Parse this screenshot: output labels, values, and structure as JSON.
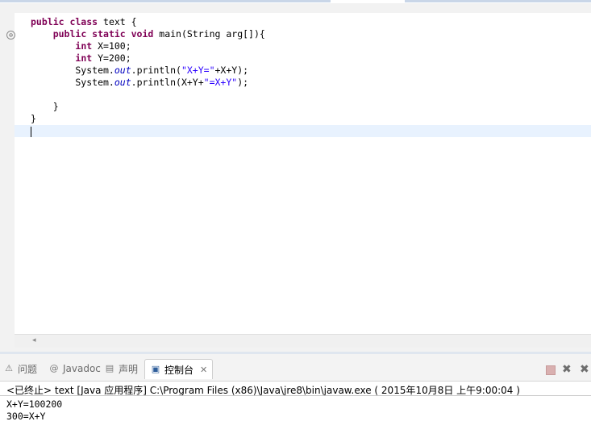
{
  "editor": {
    "code_lines": [
      [
        {
          "t": "public class ",
          "c": "kw"
        },
        {
          "t": "text {",
          "c": ""
        }
      ],
      [
        {
          "t": "    ",
          "c": ""
        },
        {
          "t": "public static void ",
          "c": "kw"
        },
        {
          "t": "main(String arg[]){",
          "c": ""
        }
      ],
      [
        {
          "t": "        ",
          "c": ""
        },
        {
          "t": "int ",
          "c": "kw"
        },
        {
          "t": "X=100;",
          "c": ""
        }
      ],
      [
        {
          "t": "        ",
          "c": ""
        },
        {
          "t": "int ",
          "c": "kw"
        },
        {
          "t": "Y=200;",
          "c": ""
        }
      ],
      [
        {
          "t": "        System.",
          "c": ""
        },
        {
          "t": "out",
          "c": "fld"
        },
        {
          "t": ".println(",
          "c": ""
        },
        {
          "t": "\"X+Y=\"",
          "c": "str"
        },
        {
          "t": "+X+Y);",
          "c": ""
        }
      ],
      [
        {
          "t": "        System.",
          "c": ""
        },
        {
          "t": "out",
          "c": "fld"
        },
        {
          "t": ".println(X+Y+",
          "c": ""
        },
        {
          "t": "\"=X+Y\"",
          "c": "str"
        },
        {
          "t": ");",
          "c": ""
        }
      ],
      [
        {
          "t": "",
          "c": ""
        }
      ],
      [
        {
          "t": "    }",
          "c": ""
        }
      ],
      [
        {
          "t": "}",
          "c": ""
        }
      ]
    ],
    "fold_glyph": "⊖",
    "scroll_left_glyph": "◂"
  },
  "console": {
    "tabs": [
      {
        "label": "问题",
        "icon": "problems-icon",
        "glyph": "⚠"
      },
      {
        "label": "Javadoc",
        "icon": "at-icon",
        "glyph": "@"
      },
      {
        "label": "声明",
        "icon": "declaration-icon",
        "glyph": "▤"
      },
      {
        "label": "控制台",
        "icon": "console-icon",
        "glyph": "▣",
        "active": true,
        "close": "✕"
      }
    ],
    "header": "<已终止> text [Java 应用程序] C:\\Program Files (x86)\\Java\\jre8\\bin\\javaw.exe ( 2015年10月8日 上午9:00:04 )",
    "output_lines": [
      "X+Y=100200",
      "300=X+Y"
    ],
    "toolbar": {
      "remove_glyph": "✖",
      "remove_all_glyph": "✖"
    }
  }
}
